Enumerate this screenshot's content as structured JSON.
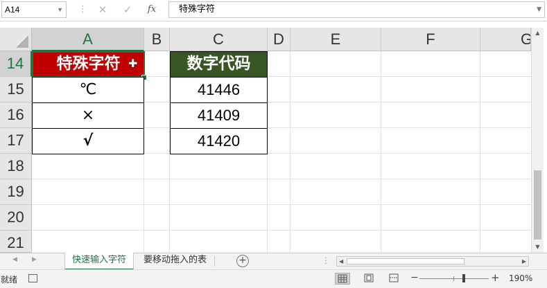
{
  "formula_bar": {
    "name_box": "A14",
    "cancel_icon": "x-icon",
    "enter_icon": "check-icon",
    "function_label": "fx",
    "content": "特殊字符"
  },
  "columns": [
    "A",
    "B",
    "C",
    "D",
    "E",
    "F",
    "G"
  ],
  "rows": [
    "14",
    "15",
    "16",
    "17",
    "18",
    "19",
    "20",
    "21"
  ],
  "table_special": {
    "header": "特殊字符",
    "values": [
      "℃",
      "×",
      "√"
    ]
  },
  "table_codes": {
    "header": "数字代码",
    "values": [
      "41446",
      "41409",
      "41420"
    ]
  },
  "sheet_tabs": {
    "active": "快速输入字符",
    "other": "要移动拖入的表",
    "add_icon": "plus-circle-icon"
  },
  "status_bar": {
    "status": "就绪",
    "zoom_level": "190%"
  },
  "colors": {
    "header_red": "#c00000",
    "header_green": "#375623",
    "excel_green": "#217346"
  }
}
